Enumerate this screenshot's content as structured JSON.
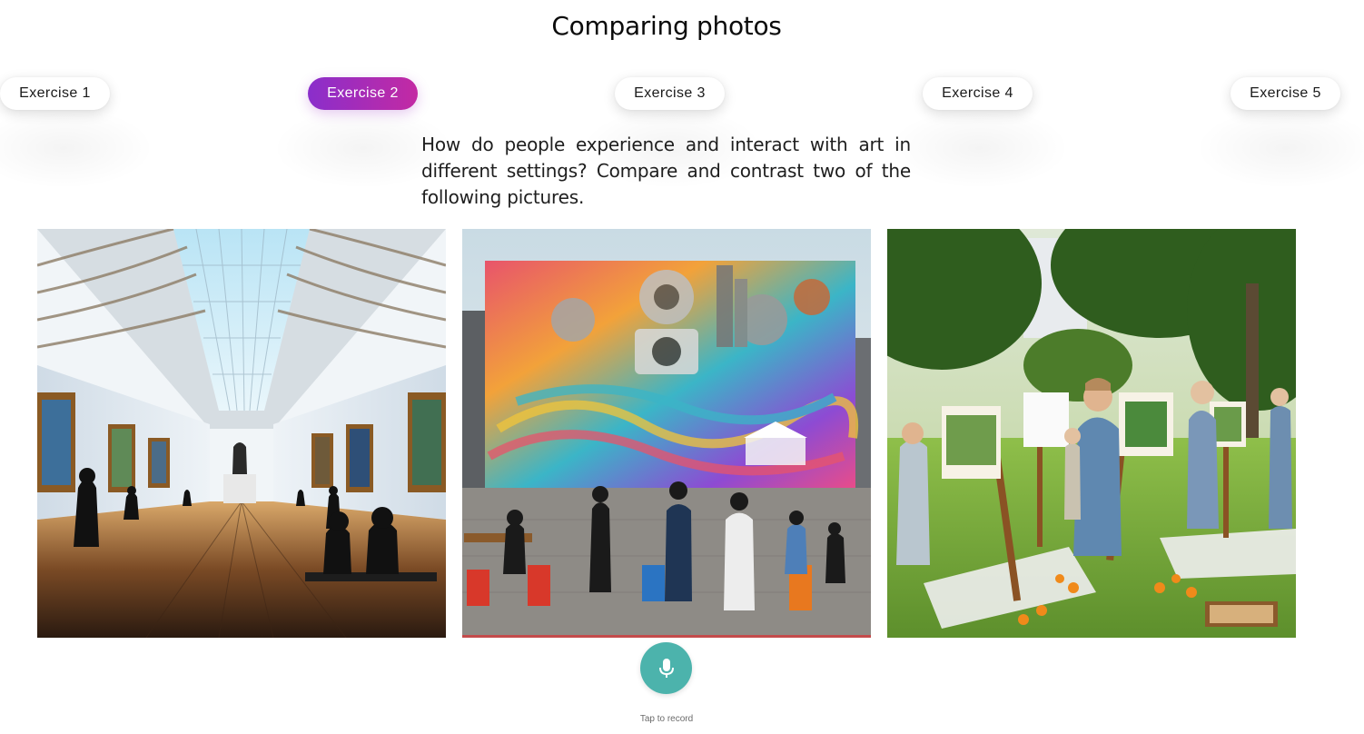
{
  "page": {
    "title": "Comparing photos"
  },
  "tabs": [
    {
      "label": "Exercise 1",
      "active": false
    },
    {
      "label": "Exercise 2",
      "active": true
    },
    {
      "label": "Exercise 3",
      "active": false
    },
    {
      "label": "Exercise 4",
      "active": false
    },
    {
      "label": "Exercise 5",
      "active": false
    }
  ],
  "prompt": {
    "text": "How do people experience and interact with art in different settings? Compare and contrast two of the following pictures."
  },
  "photos": [
    {
      "subject": "indoor art gallery with skylight ceiling and visitors viewing paintings"
    },
    {
      "subject": "outdoor street art mural with people photographing and sitting at tables"
    },
    {
      "subject": "people painting on easels in a sunny park"
    }
  ],
  "recorder": {
    "icon": "microphone-icon",
    "hint": "Tap to record"
  },
  "colors": {
    "active_tab_start": "#8a2ecb",
    "active_tab_end": "#c32aa3",
    "record_button": "#4cb3ac"
  }
}
